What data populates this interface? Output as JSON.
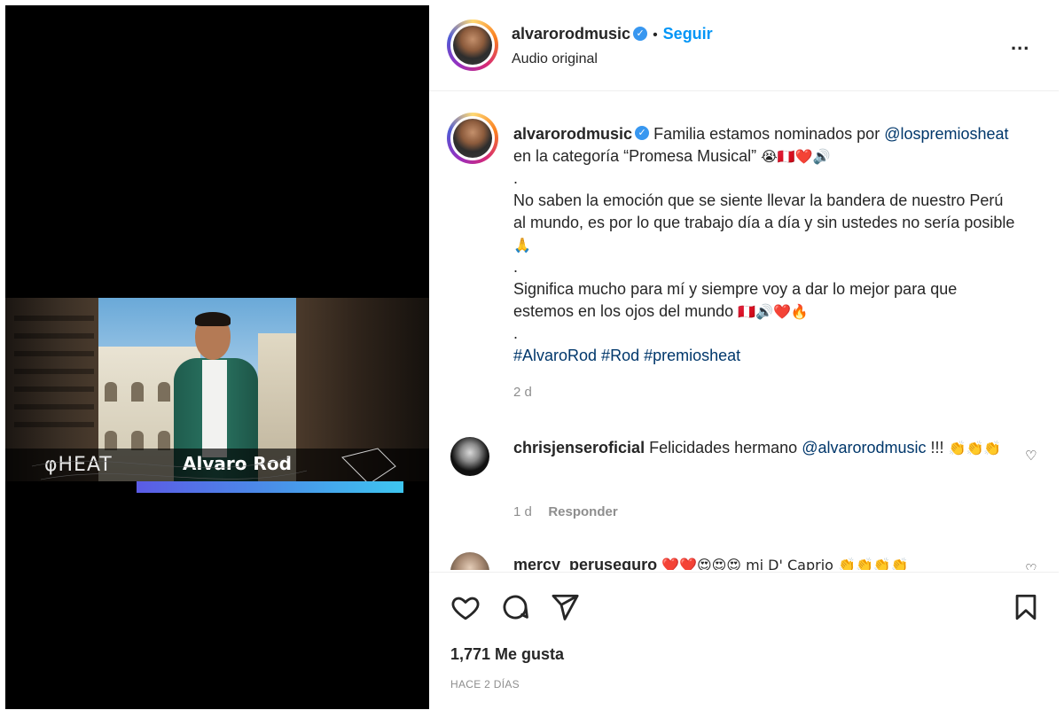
{
  "header": {
    "username": "alvarorodmusic",
    "separator": "•",
    "follow_label": "Seguir",
    "subtitle": "Audio original",
    "more_label": "..."
  },
  "media": {
    "brand_text": "φHEAT",
    "name_text": "Alvaro Rod"
  },
  "caption": {
    "username": "alvarorodmusic",
    "text_1": "Familia estamos nominados por",
    "mention": "@lospremiosheat",
    "text_2": " en la categoría “Promesa Musical” ",
    "emoji_line_1": "😭🇵🇪❤️🔊",
    "dot_1": ".",
    "paragraph_2": "No saben la emoción que se siente llevar la bandera de nuestro Perú al mundo, es por lo que trabajo día a día y sin ustedes no sería posible ",
    "emoji_pray": "🙏",
    "dot_2": ".",
    "paragraph_3": "Significa mucho para mí y siempre voy a dar lo mejor para que estemos en los ojos del mundo ",
    "emoji_line_3": "🇵🇪🔊❤️🔥",
    "dot_3": ".",
    "hashtags": "#AlvaroRod #Rod #premiosheat",
    "time": "2 d"
  },
  "comments": [
    {
      "username": "chrisjenseroficial",
      "text": "Felicidades hermano ",
      "mention": "@alvarorodmusic",
      "text_after": " !!! ",
      "emojis": "👏👏👏",
      "time": "1 d",
      "reply_label": "Responder"
    },
    {
      "username": "mercy_peruseguro",
      "text": "❤️❤️😍😍😍 mi D' Caprio 👏👏👏👏"
    }
  ],
  "actions": {
    "likes": "1,771 Me gusta",
    "posted_ago": "HACE 2 DÍAS"
  },
  "colors": {
    "accent": "#0095f6",
    "link": "#00376b",
    "muted": "#8e8e8e",
    "text": "#262626"
  },
  "icons": [
    "more-options-icon",
    "verified-icon",
    "heart-icon",
    "comment-icon",
    "share-icon",
    "bookmark-icon"
  ]
}
